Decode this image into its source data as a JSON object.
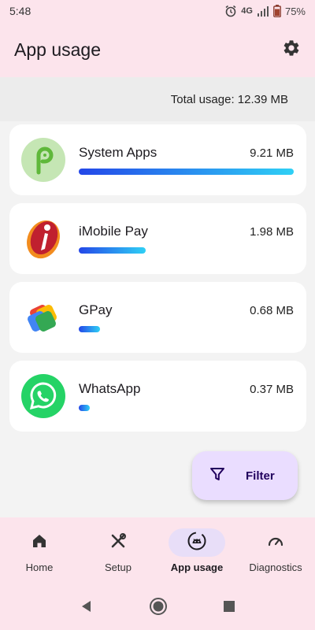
{
  "status_bar": {
    "time": "5:48",
    "network": "4G",
    "battery": "75%",
    "icons": [
      "alarm-icon",
      "network-4g-icon",
      "signal-icon",
      "battery-icon"
    ]
  },
  "app_bar": {
    "title": "App usage",
    "settings_icon": "gear-icon"
  },
  "summary": {
    "total_usage": "Total usage: 12.39 MB"
  },
  "apps": [
    {
      "name": "System Apps",
      "size": "9.21 MB",
      "usage_fraction": 1.0,
      "icon": "android-pie-icon"
    },
    {
      "name": "iMobile Pay",
      "size": "1.98 MB",
      "usage_fraction": 0.31,
      "icon": "icici-imobile-icon"
    },
    {
      "name": "GPay",
      "size": "0.68 MB",
      "usage_fraction": 0.1,
      "icon": "google-pay-icon"
    },
    {
      "name": "WhatsApp",
      "size": "0.37 MB",
      "usage_fraction": 0.05,
      "icon": "whatsapp-icon"
    }
  ],
  "filter_button": {
    "label": "Filter",
    "icon": "filter-icon"
  },
  "bottom_nav": {
    "items": [
      {
        "label": "Home",
        "icon": "home-icon",
        "active": false
      },
      {
        "label": "Setup",
        "icon": "tools-icon",
        "active": false
      },
      {
        "label": "App usage",
        "icon": "android-icon",
        "active": true
      },
      {
        "label": "Diagnostics",
        "icon": "speedometer-icon",
        "active": false
      }
    ]
  },
  "system_nav": {
    "icons": [
      "back-icon",
      "home-circle-icon",
      "recents-icon"
    ]
  },
  "colors": {
    "header_bg": "#fce4ec",
    "list_bg": "#f3f3f3",
    "fab_bg": "#eaddff",
    "nav_active_pill": "#e8def8",
    "bar_gradient_start": "#2447e8",
    "bar_gradient_end": "#2fd0f5"
  }
}
